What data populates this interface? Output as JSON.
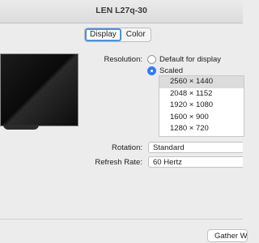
{
  "window": {
    "title": "LEN L27q-30"
  },
  "tabs": [
    {
      "label": "Display"
    },
    {
      "label": "Color"
    }
  ],
  "resolution": {
    "label": "Resolution:",
    "options": [
      {
        "label": "Default for display",
        "selected": false
      },
      {
        "label": "Scaled",
        "selected": true
      }
    ],
    "scaled_list": [
      "2560 × 1440",
      "2048 × 1152",
      "1920 × 1080",
      "1600 × 900",
      "1280 × 720"
    ],
    "selected_index": 0
  },
  "rotation": {
    "label": "Rotation:",
    "value": "Standard"
  },
  "refresh_rate": {
    "label": "Refresh Rate:",
    "value": "60 Hertz"
  },
  "footer": {
    "gather_label": "Gather Windows"
  }
}
